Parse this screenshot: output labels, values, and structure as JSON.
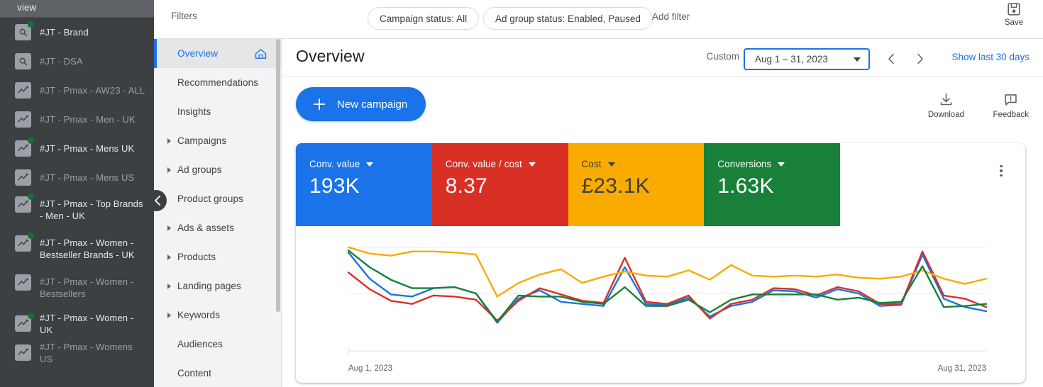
{
  "sidebar": {
    "top_band_text": "view",
    "accounts": [
      {
        "label": "#JT - Brand",
        "icon": "search-icon",
        "active": true,
        "dot": true
      },
      {
        "label": "#JT - DSA",
        "icon": "search-icon",
        "active": false,
        "dot": false
      },
      {
        "label": "#JT - Pmax - AW23 - ALL",
        "icon": "trend-icon",
        "active": false,
        "dot": false
      },
      {
        "label": "#JT - Pmax - Men - UK",
        "icon": "trend-icon",
        "active": false,
        "dot": false
      },
      {
        "label": "#JT - Pmax - Mens UK",
        "icon": "trend-icon",
        "active": true,
        "dot": true
      },
      {
        "label": "#JT - Pmax - Mens US",
        "icon": "trend-icon",
        "active": false,
        "dot": false
      },
      {
        "label": "#JT - Pmax - Top Brands - Men - UK",
        "icon": "trend-icon",
        "active": true,
        "dot": true
      },
      {
        "label": "#JT - Pmax - Women - Bestseller Brands - UK",
        "icon": "trend-icon",
        "active": true,
        "dot": true
      },
      {
        "label": "#JT - Pmax - Women - Bestsellers",
        "icon": "trend-icon",
        "active": false,
        "dot": false
      },
      {
        "label": "#JT - Pmax - Women - UK",
        "icon": "trend-icon",
        "active": true,
        "dot": true
      },
      {
        "label": "#JT - Pmax - Womens US",
        "icon": "trend-icon",
        "active": false,
        "dot": false
      }
    ]
  },
  "nav": {
    "items": [
      {
        "label": "Overview",
        "selected": true,
        "expandable": false,
        "home_icon": true
      },
      {
        "label": "Recommendations",
        "selected": false,
        "expandable": false,
        "home_icon": false
      },
      {
        "label": "Insights",
        "selected": false,
        "expandable": false,
        "home_icon": false
      },
      {
        "label": "Campaigns",
        "selected": false,
        "expandable": true,
        "home_icon": false
      },
      {
        "label": "Ad groups",
        "selected": false,
        "expandable": true,
        "home_icon": false
      },
      {
        "label": "Product groups",
        "selected": false,
        "expandable": false,
        "home_icon": false
      },
      {
        "label": "Ads & assets",
        "selected": false,
        "expandable": true,
        "home_icon": false
      },
      {
        "label": "Products",
        "selected": false,
        "expandable": true,
        "home_icon": false
      },
      {
        "label": "Landing pages",
        "selected": false,
        "expandable": true,
        "home_icon": false
      },
      {
        "label": "Keywords",
        "selected": false,
        "expandable": true,
        "home_icon": false
      },
      {
        "label": "Audiences",
        "selected": false,
        "expandable": false,
        "home_icon": false
      },
      {
        "label": "Content",
        "selected": false,
        "expandable": false,
        "home_icon": false
      }
    ]
  },
  "filterbar": {
    "filters_label": "Filters",
    "chip_campaign_status": "Campaign status: All",
    "chip_adgroup_status": "Ad group status: Enabled, Paused",
    "add_filter_label": "Add filter",
    "save_label": "Save"
  },
  "header": {
    "title": "Overview",
    "range_label": "Custom",
    "date_value": "Aug 1 – 31, 2023",
    "show_last_30_label": "Show last 30 days"
  },
  "actions": {
    "new_campaign_label": "New campaign",
    "download_label": "Download",
    "feedback_label": "Feedback"
  },
  "chart_data": {
    "type": "line",
    "title": "",
    "xlabel": "",
    "ylabel": "",
    "x_start_label": "Aug 1, 2023",
    "x_end_label": "Aug 31, 2023",
    "grid": true,
    "legend_position": "scorecards-above",
    "x": [
      "Aug 1, 2023",
      "Aug 2, 2023",
      "Aug 3, 2023",
      "Aug 4, 2023",
      "Aug 5, 2023",
      "Aug 6, 2023",
      "Aug 7, 2023",
      "Aug 8, 2023",
      "Aug 9, 2023",
      "Aug 10, 2023",
      "Aug 11, 2023",
      "Aug 12, 2023",
      "Aug 13, 2023",
      "Aug 14, 2023",
      "Aug 15, 2023",
      "Aug 16, 2023",
      "Aug 17, 2023",
      "Aug 18, 2023",
      "Aug 19, 2023",
      "Aug 20, 2023",
      "Aug 21, 2023",
      "Aug 22, 2023",
      "Aug 23, 2023",
      "Aug 24, 2023",
      "Aug 25, 2023",
      "Aug 26, 2023",
      "Aug 27, 2023",
      "Aug 28, 2023",
      "Aug 29, 2023",
      "Aug 30, 2023",
      "Aug 31, 2023"
    ],
    "ylim": [
      0,
      100
    ],
    "series": [
      {
        "name": "Conv. value",
        "color": "#1a73e8",
        "values": [
          87,
          62,
          47,
          45,
          53,
          54,
          48,
          20,
          43,
          51,
          40,
          38,
          36,
          73,
          38,
          37,
          44,
          26,
          36,
          40,
          51,
          50,
          44,
          52,
          48,
          36,
          37,
          85,
          43,
          35,
          31
        ]
      },
      {
        "name": "Conv. value / cost",
        "color": "#d93025",
        "values": [
          68,
          52,
          41,
          38,
          46,
          45,
          42,
          22,
          41,
          53,
          47,
          41,
          39,
          82,
          40,
          38,
          46,
          24,
          38,
          42,
          53,
          52,
          46,
          54,
          50,
          38,
          38,
          88,
          46,
          43,
          35
        ]
      },
      {
        "name": "Cost",
        "color": "#f9ab00",
        "values": [
          92,
          86,
          84,
          88,
          88,
          87,
          85,
          45,
          58,
          66,
          71,
          58,
          64,
          69,
          65,
          64,
          70,
          61,
          75,
          65,
          64,
          65,
          64,
          66,
          63,
          62,
          64,
          70,
          62,
          57,
          62
        ]
      },
      {
        "name": "Conversions",
        "color": "#188038",
        "values": [
          89,
          73,
          61,
          53,
          53,
          54,
          48,
          21,
          46,
          45,
          45,
          40,
          38,
          54,
          36,
          36,
          42,
          30,
          42,
          47,
          47,
          47,
          47,
          42,
          44,
          39,
          40,
          74,
          35,
          36,
          38
        ]
      }
    ]
  },
  "scorecards": [
    {
      "label": "Conv. value",
      "value": "193K",
      "bg": "#1a73e8",
      "fg": "#ffffff"
    },
    {
      "label": "Conv. value / cost",
      "value": "8.37",
      "bg": "#d93025",
      "fg": "#ffffff"
    },
    {
      "label": "Cost",
      "value": "£23.1K",
      "bg": "#f9ab00",
      "fg": "#3c4043"
    },
    {
      "label": "Conversions",
      "value": "1.63K",
      "bg": "#188038",
      "fg": "#ffffff"
    }
  ]
}
